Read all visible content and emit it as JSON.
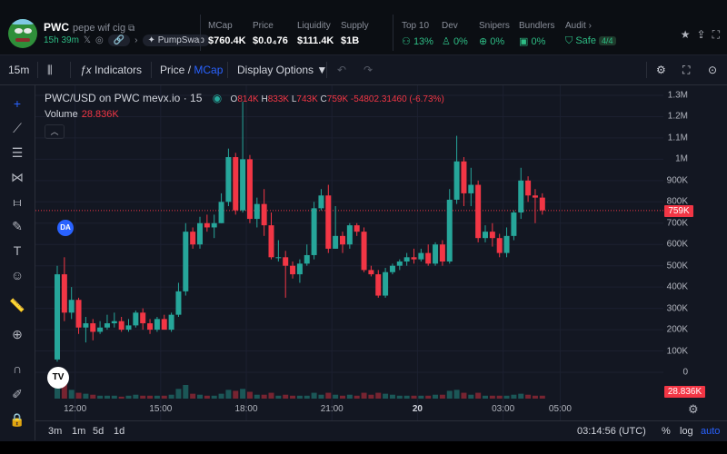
{
  "token": {
    "symbol": "PWC",
    "name": "pepe wif cig",
    "age": "15h 39m",
    "platform": "PumpSwap"
  },
  "stats": [
    {
      "label": "MCap",
      "value": "$760.4K"
    },
    {
      "label": "Price",
      "value": "$0.0₄76"
    },
    {
      "label": "Liquidity",
      "value": "$111.4K"
    },
    {
      "label": "Supply",
      "value": "$1B"
    },
    {
      "label": "Top 10",
      "value": "13%"
    },
    {
      "label": "Dev",
      "value": "0%"
    },
    {
      "label": "Snipers",
      "value": "0%"
    },
    {
      "label": "Bundlers",
      "value": "0%"
    },
    {
      "label": "Audit",
      "value": "Safe",
      "badge": "4/4"
    }
  ],
  "toolbar": {
    "interval": "15m",
    "indicators": "Indicators",
    "price_label": "Price",
    "slash": "/",
    "mcap_label": "MCap",
    "display_options": "Display Options ▼"
  },
  "legend": {
    "title": "PWC/USD on PWC mevx.io · 15",
    "o_label": "O",
    "o_value": "814K",
    "h_label": "H",
    "h_value": "833K",
    "l_label": "L",
    "l_value": "743K",
    "c_label": "C",
    "c_value": "759K",
    "change": "-54802.31460 (-6.73%)",
    "volume_label": "Volume",
    "volume_value": "28.836K"
  },
  "markers": {
    "da": "DA",
    "tv_logo": "TV"
  },
  "price_axis": [
    "1.3M",
    "1.2M",
    "1.1M",
    "1M",
    "900K",
    "800K",
    "700K",
    "600K",
    "500K",
    "400K",
    "300K",
    "200K",
    "100K",
    "0"
  ],
  "current_price_label": "759K",
  "volume_axis_label": "28.836K",
  "time_axis": [
    "12:00",
    "15:00",
    "18:00",
    "21:00",
    "20",
    "03:00",
    "05:00"
  ],
  "bottom": {
    "ranges": [
      "3m",
      "1m",
      "5d",
      "1d"
    ],
    "clock": "03:14:56 (UTC)",
    "percent": "%",
    "log": "log",
    "auto": "auto"
  },
  "colors": {
    "up": "#26a69a",
    "down": "#f23645",
    "accent": "#2962ff",
    "positive": "#2ebd85"
  },
  "chart_data": {
    "type": "candlestick",
    "title": "PWC/USD on PWC mevx.io · 15",
    "ylim": [
      0,
      1300000
    ],
    "y_ticks": [
      "1.3M",
      "1.2M",
      "1.1M",
      "1M",
      "900K",
      "800K",
      "700K",
      "600K",
      "500K",
      "400K",
      "300K",
      "200K",
      "100K",
      "0"
    ],
    "x_ticks": [
      "12:00",
      "15:00",
      "18:00",
      "21:00",
      "20",
      "03:00",
      "05:00"
    ],
    "x_tick_index": [
      2.5,
      14.5,
      26.5,
      38.5,
      50.5,
      62.5,
      70.5
    ],
    "current_price": 759000,
    "candles": [
      [
        60000,
        460000,
        500000,
        50000,
        14000
      ],
      [
        460000,
        280000,
        540000,
        240000,
        20000
      ],
      [
        280000,
        340000,
        400000,
        250000,
        9000
      ],
      [
        340000,
        210000,
        350000,
        180000,
        6000
      ],
      [
        210000,
        230000,
        260000,
        140000,
        5000
      ],
      [
        230000,
        190000,
        250000,
        150000,
        4000
      ],
      [
        190000,
        210000,
        240000,
        180000,
        3000
      ],
      [
        210000,
        230000,
        270000,
        200000,
        3000
      ],
      [
        230000,
        240000,
        280000,
        210000,
        3000
      ],
      [
        240000,
        200000,
        260000,
        190000,
        2000
      ],
      [
        200000,
        220000,
        250000,
        190000,
        3000
      ],
      [
        220000,
        280000,
        290000,
        210000,
        4000
      ],
      [
        280000,
        230000,
        300000,
        200000,
        3000
      ],
      [
        230000,
        200000,
        250000,
        180000,
        3000
      ],
      [
        200000,
        250000,
        260000,
        190000,
        3000
      ],
      [
        250000,
        200000,
        270000,
        200000,
        3000
      ],
      [
        200000,
        270000,
        280000,
        190000,
        4000
      ],
      [
        270000,
        380000,
        420000,
        260000,
        10000
      ],
      [
        380000,
        660000,
        700000,
        360000,
        14000
      ],
      [
        660000,
        600000,
        680000,
        580000,
        5000
      ],
      [
        600000,
        700000,
        730000,
        580000,
        4000
      ],
      [
        700000,
        680000,
        740000,
        660000,
        3000
      ],
      [
        680000,
        700000,
        740000,
        630000,
        3000
      ],
      [
        700000,
        800000,
        840000,
        700000,
        5000
      ],
      [
        800000,
        1010000,
        1050000,
        780000,
        9000
      ],
      [
        1010000,
        760000,
        1030000,
        740000,
        8000
      ],
      [
        760000,
        1000000,
        1270000,
        750000,
        10000
      ],
      [
        1000000,
        720000,
        1020000,
        700000,
        7000
      ],
      [
        720000,
        790000,
        820000,
        680000,
        4000
      ],
      [
        790000,
        690000,
        860000,
        640000,
        4000
      ],
      [
        690000,
        540000,
        750000,
        530000,
        6000
      ],
      [
        540000,
        540000,
        620000,
        520000,
        3000
      ],
      [
        540000,
        500000,
        570000,
        350000,
        4000
      ],
      [
        500000,
        460000,
        520000,
        440000,
        3000
      ],
      [
        460000,
        510000,
        530000,
        420000,
        3000
      ],
      [
        510000,
        550000,
        600000,
        500000,
        3000
      ],
      [
        550000,
        770000,
        800000,
        530000,
        6000
      ],
      [
        770000,
        830000,
        860000,
        760000,
        4000
      ],
      [
        830000,
        580000,
        880000,
        560000,
        6000
      ],
      [
        580000,
        640000,
        780000,
        580000,
        4000
      ],
      [
        640000,
        600000,
        660000,
        560000,
        3000
      ],
      [
        600000,
        690000,
        700000,
        580000,
        4000
      ],
      [
        690000,
        660000,
        700000,
        640000,
        3000
      ],
      [
        660000,
        480000,
        680000,
        470000,
        6000
      ],
      [
        480000,
        460000,
        500000,
        450000,
        4000
      ],
      [
        460000,
        360000,
        480000,
        350000,
        6000
      ],
      [
        360000,
        470000,
        490000,
        350000,
        5000
      ],
      [
        470000,
        500000,
        510000,
        460000,
        4000
      ],
      [
        500000,
        520000,
        530000,
        480000,
        3000
      ],
      [
        520000,
        540000,
        560000,
        500000,
        3000
      ],
      [
        540000,
        530000,
        580000,
        510000,
        3000
      ],
      [
        530000,
        560000,
        580000,
        520000,
        3000
      ],
      [
        560000,
        510000,
        600000,
        500000,
        3000
      ],
      [
        510000,
        600000,
        610000,
        500000,
        4000
      ],
      [
        600000,
        520000,
        620000,
        500000,
        4000
      ],
      [
        520000,
        810000,
        860000,
        510000,
        8000
      ],
      [
        810000,
        990000,
        1110000,
        790000,
        9000
      ],
      [
        990000,
        840000,
        1010000,
        780000,
        6000
      ],
      [
        840000,
        880000,
        960000,
        780000,
        4000
      ],
      [
        880000,
        630000,
        900000,
        610000,
        6000
      ],
      [
        630000,
        660000,
        690000,
        610000,
        3000
      ],
      [
        660000,
        630000,
        700000,
        590000,
        3000
      ],
      [
        630000,
        560000,
        650000,
        540000,
        3000
      ],
      [
        560000,
        640000,
        680000,
        540000,
        3000
      ],
      [
        640000,
        750000,
        760000,
        620000,
        4000
      ],
      [
        750000,
        900000,
        960000,
        720000,
        5000
      ],
      [
        900000,
        830000,
        920000,
        800000,
        4000
      ],
      [
        830000,
        820000,
        860000,
        700000,
        3000
      ],
      [
        820000,
        760000,
        840000,
        740000,
        3000
      ]
    ]
  }
}
